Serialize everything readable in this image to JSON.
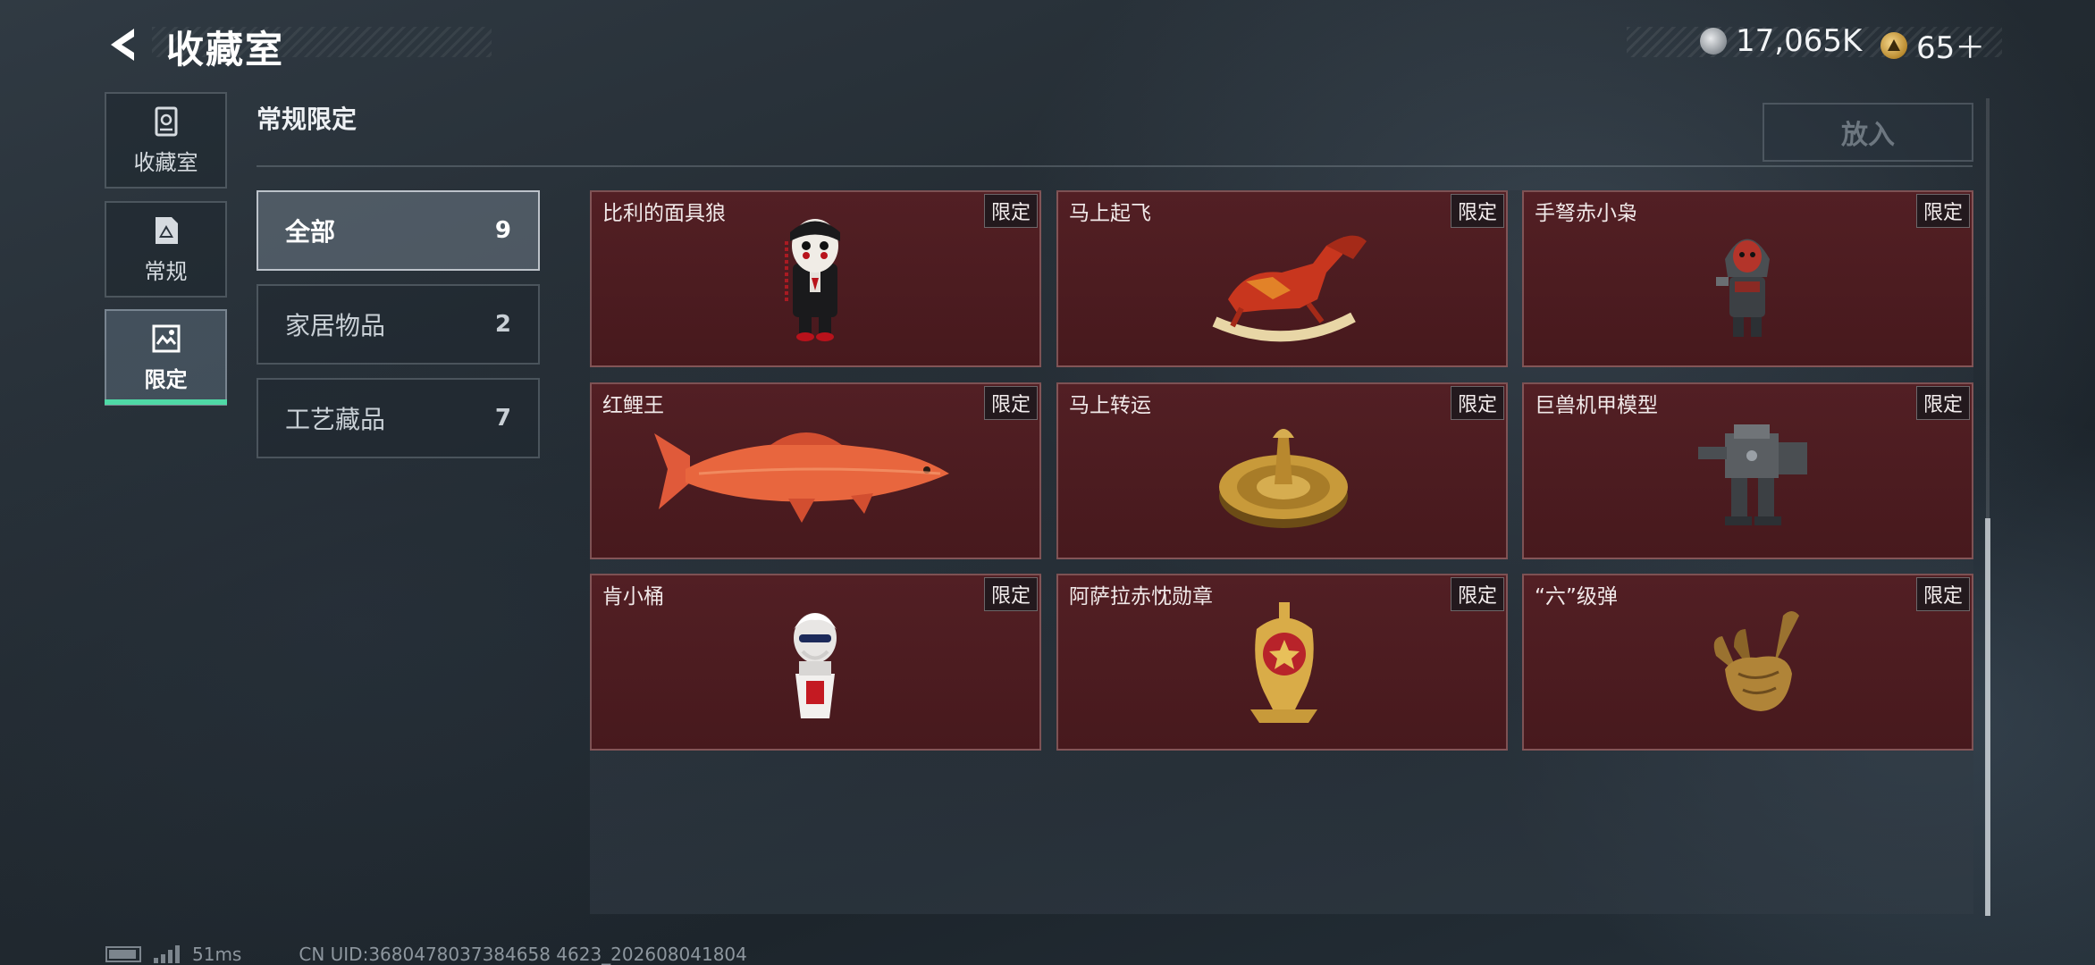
{
  "header": {
    "title": "收藏室",
    "currency_coin": "17,065K",
    "currency_token": "65＋"
  },
  "nav": {
    "items": [
      {
        "label": "收藏室",
        "icon": "vault-icon"
      },
      {
        "label": "常规",
        "icon": "document-icon"
      },
      {
        "label": "限定",
        "icon": "artwork-icon",
        "active": true
      }
    ]
  },
  "section": {
    "title": "常规限定",
    "place_button": "放入"
  },
  "filters": [
    {
      "label": "全部",
      "count": "9",
      "active": true
    },
    {
      "label": "家居物品",
      "count": "2"
    },
    {
      "label": "工艺藏品",
      "count": "7"
    }
  ],
  "cards": [
    {
      "name": "比利的面具狼",
      "badge": "限定",
      "icon": "puppet-doll-icon"
    },
    {
      "name": "马上起飞",
      "badge": "限定",
      "icon": "rocking-horse-icon"
    },
    {
      "name": "手弩赤小枭",
      "badge": "限定",
      "icon": "hooded-figure-icon"
    },
    {
      "name": "红鲤王",
      "badge": "限定",
      "icon": "red-carp-icon"
    },
    {
      "name": "马上转运",
      "badge": "限定",
      "icon": "golden-dial-icon"
    },
    {
      "name": "巨兽机甲模型",
      "badge": "限定",
      "icon": "mech-model-icon"
    },
    {
      "name": "肯小桶",
      "badge": "限定",
      "icon": "bucket-figure-icon"
    },
    {
      "name": "阿萨拉赤忱勋章",
      "badge": "限定",
      "icon": "gold-medal-icon"
    },
    {
      "name": "“六”级弹",
      "badge": "限定",
      "icon": "golden-hand-icon"
    }
  ],
  "footer": {
    "ping": "51ms",
    "uid": "CN UID:3680478037384658 4623_202608041804"
  },
  "colors": {
    "accent": "#4fd9a6",
    "card_bg": "#4a1c20"
  }
}
